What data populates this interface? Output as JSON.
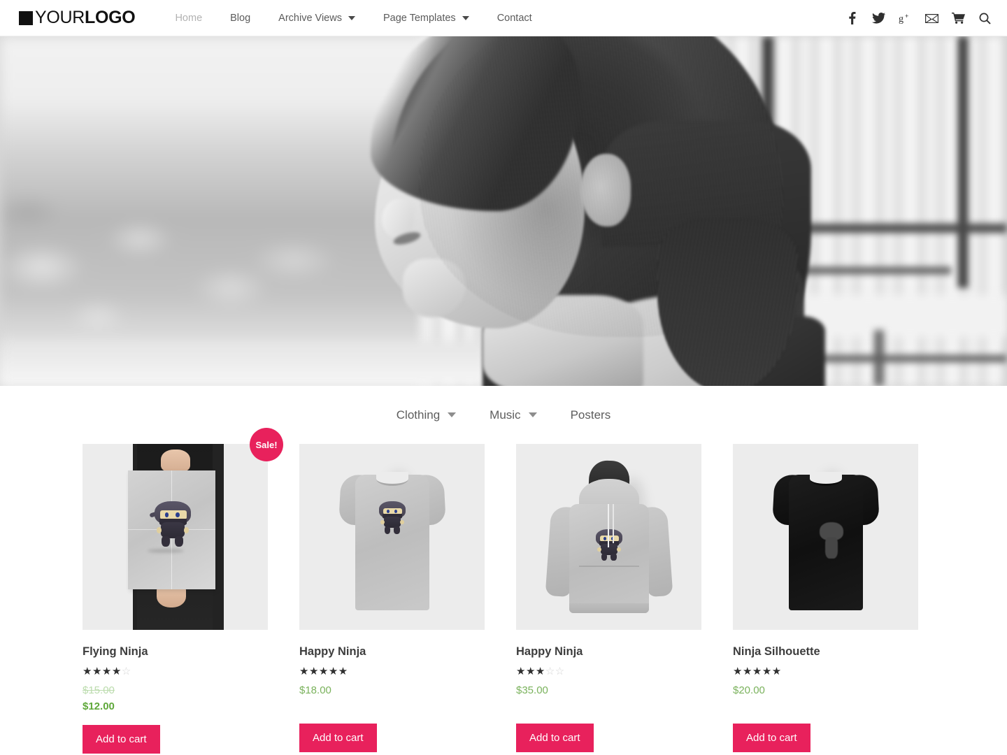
{
  "header": {
    "logo": {
      "mark": "square-logo-mark",
      "light": "YOUR",
      "bold": "LOGO"
    },
    "nav": [
      {
        "label": "Home",
        "has_dropdown": false,
        "active": true
      },
      {
        "label": "Blog",
        "has_dropdown": false,
        "active": false
      },
      {
        "label": "Archive Views",
        "has_dropdown": true,
        "active": false
      },
      {
        "label": "Page Templates",
        "has_dropdown": true,
        "active": false
      },
      {
        "label": "Contact",
        "has_dropdown": false,
        "active": false
      }
    ],
    "social": [
      {
        "name": "facebook-icon"
      },
      {
        "name": "twitter-icon"
      },
      {
        "name": "google-plus-icon"
      },
      {
        "name": "email-icon"
      },
      {
        "name": "cart-icon"
      },
      {
        "name": "search-icon"
      }
    ]
  },
  "hero": {
    "alt": "Black and white photo of a woman in profile wearing a sleeveless denim vest"
  },
  "filters": [
    {
      "label": "Clothing",
      "has_dropdown": true
    },
    {
      "label": "Music",
      "has_dropdown": true
    },
    {
      "label": "Posters",
      "has_dropdown": false
    }
  ],
  "products": [
    {
      "title": "Flying Ninja",
      "rating": 4,
      "rating_max": 5,
      "on_sale": true,
      "sale_label": "Sale!",
      "old_price": "$15.00",
      "price": "$12.00",
      "button": "Add to cart",
      "image_alt": "Person holding a poster with a flying ninja character"
    },
    {
      "title": "Happy Ninja",
      "rating": 5,
      "rating_max": 5,
      "on_sale": false,
      "sale_label": "",
      "old_price": "",
      "price": "$18.00",
      "button": "Add to cart",
      "image_alt": "Grey t-shirt with a ninja graphic"
    },
    {
      "title": "Happy Ninja",
      "rating": 3,
      "rating_max": 5,
      "on_sale": false,
      "sale_label": "",
      "old_price": "",
      "price": "$35.00",
      "button": "Add to cart",
      "image_alt": "Grey hooded sweatshirt with a ninja graphic"
    },
    {
      "title": "Ninja Silhouette",
      "rating": 5,
      "rating_max": 5,
      "on_sale": false,
      "sale_label": "",
      "old_price": "",
      "price": "$20.00",
      "button": "Add to cart",
      "image_alt": "Black t-shirt with a dark ninja silhouette graphic"
    }
  ],
  "colors": {
    "accent_pink": "#e8215c",
    "price_green": "#7ab25c",
    "sale_price_green": "#5fa83a",
    "old_price_green": "#bcdcae",
    "nav_text": "#5b5b5b",
    "nav_active": "#b2b2b2",
    "media_bg": "#ececec"
  }
}
